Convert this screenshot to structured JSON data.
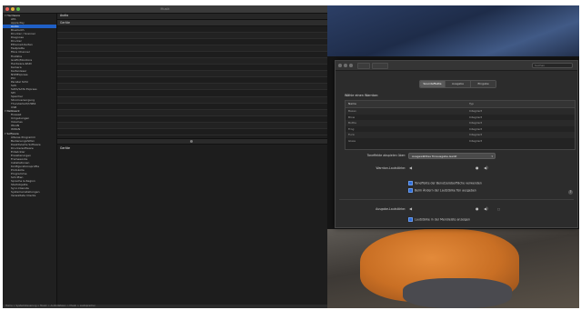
{
  "window": {
    "title": "Musik",
    "status_text": "Home > Systemsteuerung > Musik > Audiodateien > Musik > Lautsprecher",
    "content_title": "Audio",
    "table_header": "Geräte",
    "detail_title": "Geräte"
  },
  "sidebar": {
    "items": [
      {
        "label": "Hardware",
        "section": true
      },
      {
        "label": "ATA"
      },
      {
        "label": "Apple Pay"
      },
      {
        "label": "Audio",
        "selected": true
      },
      {
        "label": "Bluetooth"
      },
      {
        "label": "Drucker / Scanner"
      },
      {
        "label": "Diagnose"
      },
      {
        "label": "Drucker"
      },
      {
        "label": "Ethernet-Karten"
      },
      {
        "label": "Festplatte"
      },
      {
        "label": "Fibre Channel"
      },
      {
        "label": "FireWire"
      },
      {
        "label": "Grafik/Monitore"
      },
      {
        "label": "Hardware-RAID"
      },
      {
        "label": "Kamera"
      },
      {
        "label": "Kartenleser"
      },
      {
        "label": "NVMExpress"
      },
      {
        "label": "PCI"
      },
      {
        "label": "Parallel SCSI"
      },
      {
        "label": "SAS"
      },
      {
        "label": "SATA/SATA Express"
      },
      {
        "label": "SPI"
      },
      {
        "label": "Speicher"
      },
      {
        "label": "Stromversorgung"
      },
      {
        "label": "Thunderbolt/USB4"
      },
      {
        "label": "USB"
      },
      {
        "label": "Netzwerk",
        "section": true
      },
      {
        "label": "Firewall"
      },
      {
        "label": "Umgebungen"
      },
      {
        "label": "Volumes"
      },
      {
        "label": "WLAN"
      },
      {
        "label": "WWAN"
      },
      {
        "label": "Software",
        "section": true
      },
      {
        "label": "Älteres Programm"
      },
      {
        "label": "Bedienungshilfen"
      },
      {
        "label": "Deaktivierte Software"
      },
      {
        "label": "Druckersoftware"
      },
      {
        "label": "Entwickler"
      },
      {
        "label": "Erweiterungen"
      },
      {
        "label": "Frameworks"
      },
      {
        "label": "Installationen"
      },
      {
        "label": "Konfigurationsprofile"
      },
      {
        "label": "Protokolle"
      },
      {
        "label": "Programme"
      },
      {
        "label": "Schriften"
      },
      {
        "label": "Sprache & Region"
      },
      {
        "label": "Startobjekte"
      },
      {
        "label": "Sync-Dienste"
      },
      {
        "label": "Systemeinstellungen"
      },
      {
        "label": "Verwaltete Clients"
      }
    ]
  },
  "settings": {
    "search_placeholder": "Suchen",
    "tabs": [
      "Soundeffekte",
      "Ausgabe",
      "Eingabe"
    ],
    "active_tab": "Soundeffekte",
    "section_heading": "Wähle einen Warnton:",
    "list_header_name": "Name",
    "list_header_type": "Typ",
    "list_rows": [
      {
        "name": "Basso",
        "type": "Integriert"
      },
      {
        "name": "Blow",
        "type": "Integriert"
      },
      {
        "name": "Bottle",
        "type": "Integriert"
      },
      {
        "name": "Frog",
        "type": "Integriert"
      },
      {
        "name": "Funk",
        "type": "Integriert"
      },
      {
        "name": "Glass",
        "type": "Integriert"
      }
    ],
    "output_label": "Toneffekte abspielen über:",
    "output_value": "Ausgewähltes Tonausgabe-Gerät",
    "alert_volume_label": "Warnton-Lautstärke:",
    "check_ui_sounds": "Toneffekte der Benutzeroberfläche verwenden",
    "check_feedback": "Beim Ändern der Lautstärke Ton ausgeben",
    "output_volume_label": "Ausgabe-Lautstärke:",
    "check_menubar": "Lautstärke in der Menüleiste anzeigen",
    "help_label": "?"
  },
  "colors": {
    "accent": "#1f5fc5",
    "window_bg": "#2c2c2c",
    "sidebar_bg": "#202020"
  }
}
